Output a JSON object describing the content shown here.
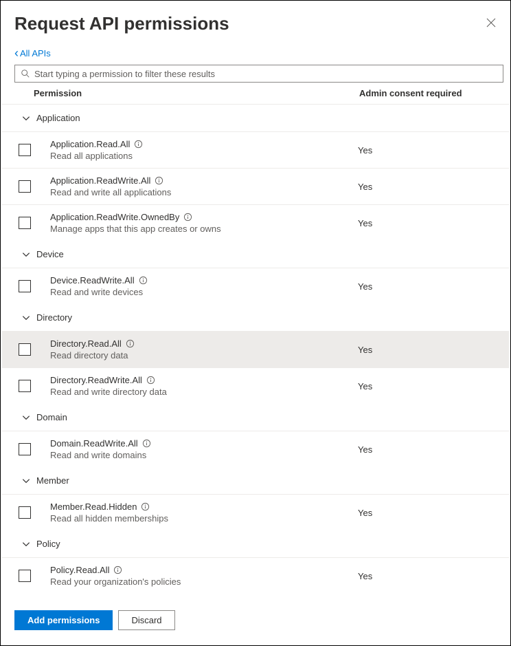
{
  "header": {
    "title": "Request API permissions",
    "back_link": "All APIs"
  },
  "search": {
    "placeholder": "Start typing a permission to filter these results"
  },
  "columns": {
    "permission": "Permission",
    "consent": "Admin consent required"
  },
  "groups": [
    {
      "name": "Application",
      "items": [
        {
          "name": "Application.Read.All",
          "desc": "Read all applications",
          "consent": "Yes",
          "highlighted": false
        },
        {
          "name": "Application.ReadWrite.All",
          "desc": "Read and write all applications",
          "consent": "Yes",
          "highlighted": false
        },
        {
          "name": "Application.ReadWrite.OwnedBy",
          "desc": "Manage apps that this app creates or owns",
          "consent": "Yes",
          "highlighted": false
        }
      ]
    },
    {
      "name": "Device",
      "items": [
        {
          "name": "Device.ReadWrite.All",
          "desc": "Read and write devices",
          "consent": "Yes",
          "highlighted": false
        }
      ]
    },
    {
      "name": "Directory",
      "items": [
        {
          "name": "Directory.Read.All",
          "desc": "Read directory data",
          "consent": "Yes",
          "highlighted": true
        },
        {
          "name": "Directory.ReadWrite.All",
          "desc": "Read and write directory data",
          "consent": "Yes",
          "highlighted": false
        }
      ]
    },
    {
      "name": "Domain",
      "items": [
        {
          "name": "Domain.ReadWrite.All",
          "desc": "Read and write domains",
          "consent": "Yes",
          "highlighted": false
        }
      ]
    },
    {
      "name": "Member",
      "items": [
        {
          "name": "Member.Read.Hidden",
          "desc": "Read all hidden memberships",
          "consent": "Yes",
          "highlighted": false
        }
      ]
    },
    {
      "name": "Policy",
      "items": [
        {
          "name": "Policy.Read.All",
          "desc": "Read your organization's policies",
          "consent": "Yes",
          "highlighted": false
        }
      ]
    }
  ],
  "footer": {
    "add": "Add permissions",
    "discard": "Discard"
  }
}
